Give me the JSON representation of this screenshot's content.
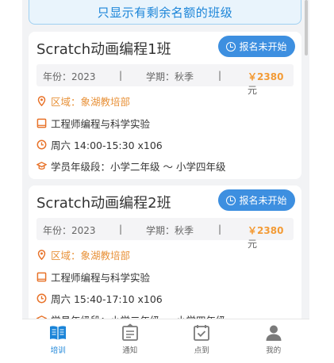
{
  "filter_banner": "只显示有剩余名额的班级",
  "classes": [
    {
      "title": "Scratch动画编程1班",
      "status": "报名未开始",
      "year_label": "年份：2023",
      "sep": "|",
      "term_label": "学期：秋季",
      "price_prefix": "￥",
      "price": "2380",
      "price_unit": "元",
      "region": "区域：象湖教培部",
      "teacher": "工程师编程与科学实验",
      "schedule": "周六 14:00-15:30 x106",
      "grade": "学员年级段：小学二年级 ～ 小学四年级"
    },
    {
      "title": "Scratch动画编程2班",
      "status": "报名未开始",
      "year_label": "年份：2023",
      "sep": "|",
      "term_label": "学期：秋季",
      "price_prefix": "￥",
      "price": "2380",
      "price_unit": "元",
      "region": "区域：象湖教培部",
      "teacher": "工程师编程与科学实验",
      "schedule": "周六 15:40-17:10 x106",
      "grade": "学员年级段：小学二年级 ～ 小学四年级"
    }
  ],
  "tabbar": [
    {
      "label": "培训",
      "icon": "training-book-icon",
      "active": true
    },
    {
      "label": "通知",
      "icon": "notice-icon",
      "active": false
    },
    {
      "label": "点到",
      "icon": "checkin-icon",
      "active": false
    },
    {
      "label": "我的",
      "icon": "profile-icon",
      "active": false
    }
  ],
  "colors": {
    "accent": "#1a84d8",
    "price": "#f39b36",
    "region": "#e8923a",
    "icon_orange": "#e8732a"
  }
}
